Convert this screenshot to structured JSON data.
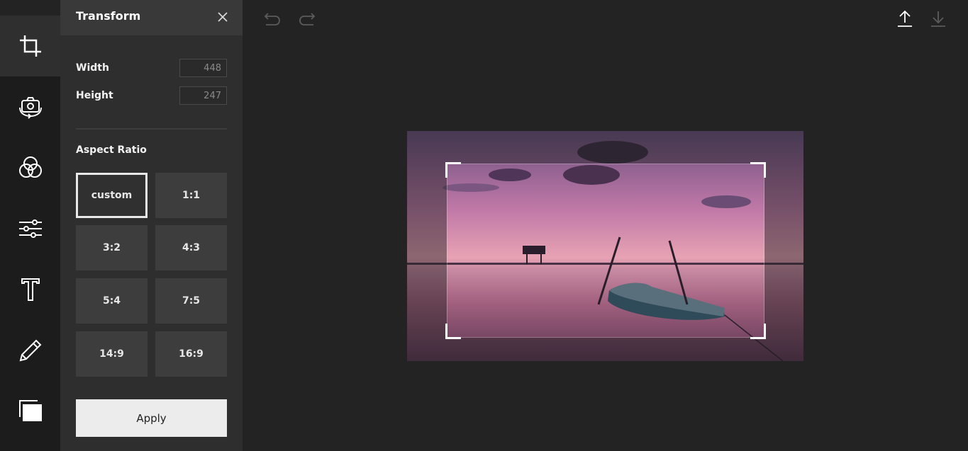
{
  "panel": {
    "title": "Transform",
    "width_label": "Width",
    "width_value": "448",
    "height_label": "Height",
    "height_value": "247",
    "aspect_title": "Aspect Ratio",
    "ratios": [
      "custom",
      "1:1",
      "3:2",
      "4:3",
      "5:4",
      "7:5",
      "14:9",
      "16:9"
    ],
    "selected_ratio": "custom",
    "apply_label": "Apply"
  },
  "sidebar": {
    "items": [
      {
        "icon": "crop-icon",
        "active": true
      },
      {
        "icon": "camera-rotate-icon",
        "active": false
      },
      {
        "icon": "color-filter-icon",
        "active": false
      },
      {
        "icon": "sliders-icon",
        "active": false
      },
      {
        "icon": "text-icon",
        "active": false
      },
      {
        "icon": "pencil-icon",
        "active": false
      },
      {
        "icon": "layers-icon",
        "active": false
      }
    ]
  },
  "toolbar": {
    "undo_icon": "undo-icon",
    "redo_icon": "redo-icon",
    "upload_icon": "upload-icon",
    "download_icon": "download-icon"
  },
  "colors": {
    "background": "#232323",
    "panel": "#2e2e2e",
    "rail": "#1c1c1c",
    "accent": "#ececec"
  }
}
